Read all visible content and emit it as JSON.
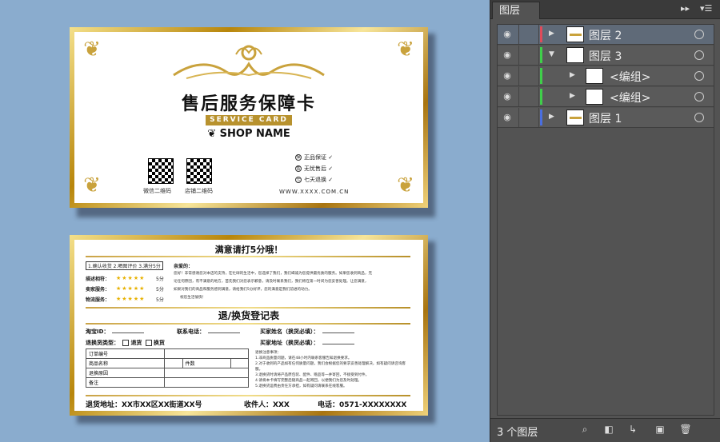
{
  "front_card": {
    "title": "售后服务保障卡",
    "subtitle": "SERVICE CARD",
    "shop_name": "SHOP NAME",
    "qr_labels": [
      "微信二维码",
      "店铺二维码"
    ],
    "features": [
      {
        "mark": "保",
        "text": "正品保证 ✓"
      },
      {
        "mark": "售",
        "text": "无忧售后 ✓"
      },
      {
        "mark": "七",
        "text": "七天退换 ✓"
      }
    ],
    "website": "WWW.XXXX.COM.CN"
  },
  "back_card": {
    "rate_title": "满意请打5分哦！",
    "steps": "1.确认收货 2.晒图评价 3.满分5分",
    "dear": "亲爱的：",
    "message_lines": [
      "您好！非常感谢您对本店的支持，在忙碌的生活中，您选择了我们，我们竭诚为您提供最优质的服务。如果您收到商品，无",
      "论任何原因，有不满意的地方，首先我们对您表示歉意，请及时联系我们，我们将在第一时间为您妥善处理。让您满意，",
      "如果对我们的商品和服务感到满意，请给我们5分好评，您的满意是我们前进的动力。",
      "祝您生活愉快！"
    ],
    "ratings": [
      {
        "label": "描述相符：",
        "stars": "★★★★★",
        "score": "5分"
      },
      {
        "label": "卖家服务：",
        "stars": "★★★★★",
        "score": "5分"
      },
      {
        "label": "物流服务：",
        "stars": "★★★★★",
        "score": "5分"
      }
    ],
    "return_title": "退/换货登记表",
    "taobao_id": "淘宝ID：",
    "contact_phone": "联系电话：",
    "buyer_name": "买家姓名（换货必填）：",
    "buyer_address": "买家地址（换货必填）：",
    "return_type": "退换货类型：",
    "opt_return": "退货",
    "opt_exchange": "换货",
    "table": {
      "order_no": "订单编号",
      "product_name": "商品名称",
      "qty": "件数",
      "reason": "退换原因",
      "note": "备注"
    },
    "notes_title": "退换注意事项：",
    "notes": [
      "1.非商品质量问题，请在48小时内联系客服告知退换要求。",
      "2.对于收到的产品如有任何质量问题，我们会根据您的要求妥善处理解决，如有疑问请咨询客服。",
      "3.退换货时请将产品原包装、配件、赠品等一并寄回，不接受到付件。",
      "4.请将本卡填写完整后随商品一起寄回，以便我们为您及时处理。",
      "5.退换货运费由责任方承担，如有疑问请联系在线客服。"
    ],
    "footer_address": "退货地址：XX市XX区XX街道XX号",
    "footer_receiver": "收件人：XXX",
    "footer_phone": "电话：0571-XXXXXXXX"
  },
  "layers_panel": {
    "tab": "图层",
    "layers": [
      {
        "name": "图层 2",
        "color": "#e04b5a",
        "expanded": false,
        "selected": true
      },
      {
        "name": "图层 3",
        "color": "#3fcf4a",
        "expanded": true,
        "selected": false
      },
      {
        "name": "<编组>",
        "color": "#3fcf4a",
        "sub": true
      },
      {
        "name": "<编组>",
        "color": "#3fcf4a",
        "sub": true
      },
      {
        "name": "图层 1",
        "color": "#4a6ee0",
        "expanded": false,
        "selected": false
      }
    ],
    "count": "3 个图层"
  }
}
